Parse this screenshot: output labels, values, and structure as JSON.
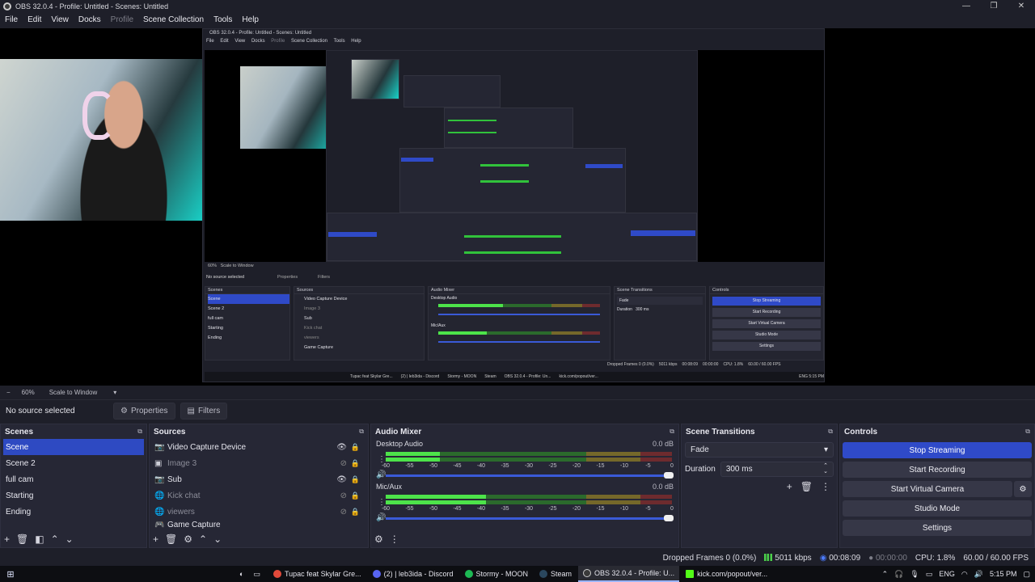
{
  "window": {
    "title": "OBS 32.0.4 - Profile: Untitled - Scenes: Untitled",
    "controls": [
      "—",
      "❐",
      "✕"
    ]
  },
  "menu": [
    "File",
    "Edit",
    "View",
    "Docks",
    "Profile",
    "Scene Collection",
    "Tools",
    "Help"
  ],
  "nested": {
    "title": "OBS 32.0.4 - Profile: Untitled - Scenes: Untitled",
    "menu": [
      "File",
      "Edit",
      "View",
      "Docks",
      "Profile",
      "Scene Collection",
      "Tools",
      "Help"
    ],
    "zoom": "60%",
    "scale_mode": "Scale to Window",
    "no_source": "No source selected",
    "properties": "Properties",
    "filters": "Filters",
    "panels": {
      "scenes": "Scenes",
      "sources": "Sources",
      "mixer": "Audio Mixer",
      "transitions": "Scene Transitions",
      "controls": "Controls"
    },
    "scenes": [
      "Scene",
      "Scene 2",
      "full cam",
      "Starting",
      "Ending"
    ],
    "sources": [
      "Video Capture Device",
      "Image 3",
      "Sub",
      "Kick chat",
      "viewers",
      "Game Capture"
    ],
    "tracks": [
      "Desktop Audio",
      "Mic/Aux"
    ],
    "transition": "Fade",
    "duration_label": "Duration",
    "duration": "300 ms",
    "controls": [
      "Stop Streaming",
      "Start Recording",
      "Start Virtual Camera",
      "Studio Mode",
      "Settings"
    ],
    "taskbar": [
      "Tupac feat Skylar Gre...",
      "(2) | leb3ida - Discord",
      "Stormy - MOON",
      "Steam",
      "OBS 32.0.4 - Profile: Un...",
      "kick.com/popout/ver..."
    ],
    "stats": {
      "dropped": "Dropped Frames 0 (0.0%)",
      "kbps": "5011 kbps",
      "time": "00:08:09",
      "rec": "00:00:00",
      "cpu": "CPU: 1.8%",
      "fps": "60.00 / 60.00 FPS",
      "clock": "5:15 PM",
      "lang": "ENG"
    }
  },
  "zoombar": {
    "minus": "−",
    "zoom": "60%",
    "scale_mode": "Scale to Window",
    "dropdown": "▾"
  },
  "propbar": {
    "no_source": "No source selected",
    "properties": "Properties",
    "filters": "Filters"
  },
  "scenes": {
    "title": "Scenes",
    "items": [
      "Scene",
      "Scene 2",
      "full cam",
      "Starting",
      "Ending"
    ],
    "selected": 0
  },
  "sources": {
    "title": "Sources",
    "items": [
      {
        "name": "Video Capture Device",
        "icon": "camera-icon",
        "visible": true
      },
      {
        "name": "Image 3",
        "icon": "image-icon",
        "visible": false
      },
      {
        "name": "Sub",
        "icon": "camera-icon",
        "visible": true
      },
      {
        "name": "Kick chat",
        "icon": "globe-icon",
        "visible": false
      },
      {
        "name": "viewers",
        "icon": "globe-icon",
        "visible": false
      },
      {
        "name": "Game Capture",
        "icon": "gamepad-icon",
        "visible": true
      }
    ]
  },
  "mixer": {
    "title": "Audio Mixer",
    "tracks": [
      {
        "name": "Desktop Audio",
        "db": "0.0 dB",
        "level": 0.19,
        "peak": 0.44
      },
      {
        "name": "Mic/Aux",
        "db": "0.0 dB",
        "level": 0.35,
        "peak": 0.88
      }
    ],
    "scale": [
      "-60",
      "-55",
      "-50",
      "-45",
      "-40",
      "-35",
      "-30",
      "-25",
      "-20",
      "-15",
      "-10",
      "-5",
      "0"
    ]
  },
  "transitions": {
    "title": "Scene Transitions",
    "selected": "Fade",
    "duration_label": "Duration",
    "duration": "300 ms"
  },
  "controls": {
    "title": "Controls",
    "stop_streaming": "Stop Streaming",
    "start_recording": "Start Recording",
    "start_virtual_camera": "Start Virtual Camera",
    "studio_mode": "Studio Mode",
    "settings": "Settings"
  },
  "status": {
    "dropped": "Dropped Frames 0 (0.0%)",
    "kbps": "5011 kbps",
    "stream_time": "00:08:09",
    "rec_time": "00:00:00",
    "cpu": "CPU: 1.8%",
    "fps": "60.00 / 60.00 FPS"
  },
  "taskbar": {
    "items": [
      {
        "label": "Tupac feat Skylar Gre...",
        "color": "#e24a3b"
      },
      {
        "label": "(2) | leb3ida - Discord",
        "color": "#5865f2"
      },
      {
        "label": "Stormy - MOON",
        "color": "#1db954"
      },
      {
        "label": "Steam",
        "color": "#2a475e"
      },
      {
        "label": "OBS 32.0.4 - Profile: U...",
        "color": "#3a3a3a"
      },
      {
        "label": "kick.com/popout/ver...",
        "color": "#53fc18"
      }
    ],
    "lang": "ENG",
    "clock": "5:15 PM"
  },
  "colors": {
    "accent": "#2f4ac8",
    "meter_green": "#4de34a",
    "bg": "#1e1f29",
    "panel": "#262735"
  }
}
